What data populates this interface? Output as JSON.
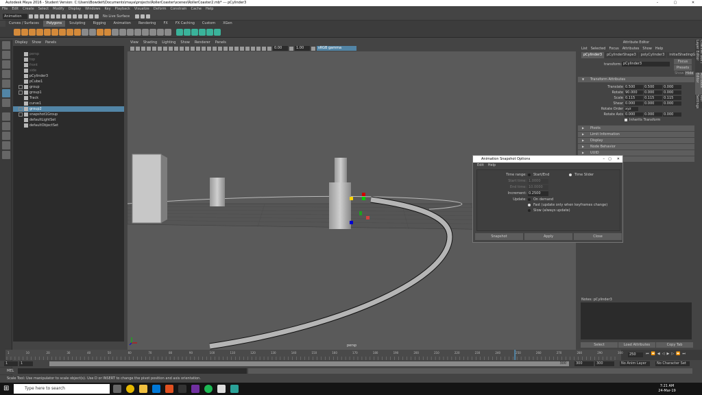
{
  "window": {
    "title": "Autodesk Maya 2016 - Student Version: C:\\Users\\Bowdeit\\Documents\\maya\\projects\\RollerCoaster\\scenes\\RollerCoaster2.mb* --- pCylinder3",
    "controls": [
      "–",
      "▢",
      "✕"
    ]
  },
  "menubar": [
    "File",
    "Edit",
    "Create",
    "Select",
    "Modify",
    "Display",
    "Windows",
    "Key",
    "Playback",
    "Visualize",
    "Deform",
    "Constrain",
    "Cache",
    "Help"
  ],
  "statusline": {
    "mode": "Animation",
    "live_surface": "No Live Surface"
  },
  "shelf_tabs": [
    "Curves / Surfaces",
    "Polygons",
    "Sculpting",
    "Rigging",
    "Animation",
    "Rendering",
    "FX",
    "FX Caching",
    "Custom",
    "XGen"
  ],
  "shelf_active": "Polygons",
  "outliner": {
    "menu": [
      "Display",
      "Show",
      "Panels"
    ],
    "items": [
      {
        "label": "persp",
        "dim": true
      },
      {
        "label": "top",
        "dim": true
      },
      {
        "label": "front",
        "dim": true
      },
      {
        "label": "side",
        "dim": true
      },
      {
        "label": "pCylinder3"
      },
      {
        "label": "pCube1"
      },
      {
        "label": "group",
        "expand": true
      },
      {
        "label": "group1",
        "expand": true
      },
      {
        "label": "Track"
      },
      {
        "label": "curve1"
      },
      {
        "label": "group2",
        "expand": true,
        "selected": true
      },
      {
        "label": "snapshot1Group",
        "expand": true
      },
      {
        "label": "defaultLightSet"
      },
      {
        "label": "defaultObjectSet"
      }
    ]
  },
  "viewport": {
    "menu": [
      "View",
      "Shading",
      "Lighting",
      "Show",
      "Renderer",
      "Panels"
    ],
    "near": "0.00",
    "far": "1.00",
    "color_space": "sRGB gamma",
    "camera_label": "persp"
  },
  "attribute_editor": {
    "title": "Attribute Editor",
    "menu": [
      "List",
      "Selected",
      "Focus",
      "Attributes",
      "Show",
      "Help"
    ],
    "tabs": [
      "pCylinder3",
      "pCylinderShape3",
      "polyCylinder3",
      "initialShadingGr"
    ],
    "transform_label": "transform:",
    "transform_value": "pCylinder3",
    "focus": "Focus",
    "presets": "Presets",
    "show": "Show",
    "hide": "Hide",
    "section_open": "Transform Attributes",
    "rows": [
      {
        "label": "Translate",
        "values": [
          "0.500",
          "0.500",
          "0.000"
        ]
      },
      {
        "label": "Rotate",
        "values": [
          "90.000",
          "0.000",
          "0.000"
        ]
      },
      {
        "label": "Scale",
        "values": [
          "0.115",
          "0.115",
          "0.115"
        ]
      },
      {
        "label": "Shear",
        "values": [
          "0.000",
          "0.000",
          "0.000"
        ]
      }
    ],
    "rotate_order_label": "Rotate Order",
    "rotate_order": "xyz",
    "rotate_axis_label": "Rotate Axis",
    "rotate_axis": [
      "0.000",
      "0.000",
      "0.000"
    ],
    "inherits": "Inherits Transform",
    "sections": [
      "Pivots",
      "Limit Information",
      "Display",
      "Node Behavior",
      "UUID",
      "Extra Attributes"
    ],
    "notes": "Notes: pCylinder3",
    "buttons": [
      "Select",
      "Load Attributes",
      "Copy Tab"
    ]
  },
  "right_tabs": [
    "Channel Box / Layer Editor",
    "Attribute Editor",
    "Tool Settings"
  ],
  "dialog": {
    "title": "Animation Snapshot Options",
    "menu": [
      "Edit",
      "Help"
    ],
    "time_range_label": "Time range:",
    "time_range_options": [
      "Start/End",
      "Time Slider"
    ],
    "start_time_label": "Start time:",
    "start_time": "1.0000",
    "end_time_label": "End time:",
    "end_time": "10.0000",
    "increment_label": "Increment:",
    "increment": "0.2500",
    "update_label": "Update:",
    "update_options": [
      "On demand",
      "Fast (update only when keyframes change)",
      "Slow (always update)"
    ],
    "buttons": [
      "Snapshot",
      "Apply",
      "Close"
    ]
  },
  "timeline": {
    "ticks": [
      "1",
      "10",
      "20",
      "30",
      "40",
      "50",
      "60",
      "70",
      "80",
      "90",
      "100",
      "110",
      "120",
      "130",
      "140",
      "150",
      "160",
      "170",
      "180",
      "190",
      "200",
      "210",
      "220",
      "230",
      "240",
      "250",
      "260",
      "270",
      "280",
      "290",
      "300"
    ],
    "current": "250",
    "range_start": "1",
    "range_inner_start": "1",
    "range_inner_end": "300",
    "range_end": "300",
    "end_field": "300",
    "anim_layer": "No Anim Layer",
    "char_set": "No Character Set"
  },
  "cmdline": {
    "lang": "MEL"
  },
  "helpline": "Scale Tool: Use manipulator to scale object(s). Use D or INSERT to change the pivot position and axis orientation.",
  "taskbar": {
    "search_placeholder": "Type here to search",
    "time": "7:21 AM",
    "date": "24-Mar-19"
  }
}
